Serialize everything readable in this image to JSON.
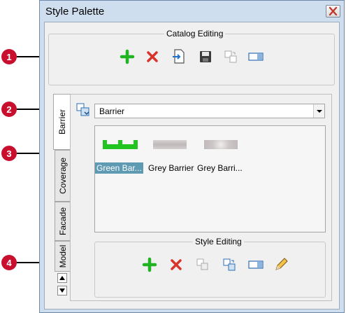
{
  "window": {
    "title": "Style Palette"
  },
  "catalog_editing": {
    "label": "Catalog Editing",
    "buttons": [
      "add-icon",
      "delete-icon",
      "import-icon",
      "save-icon",
      "copy-icon",
      "rename-icon"
    ]
  },
  "tabs": [
    {
      "label": "Barrier",
      "active": true
    },
    {
      "label": "Coverage",
      "active": false
    },
    {
      "label": "Facade",
      "active": false
    },
    {
      "label": "Model",
      "active": false
    }
  ],
  "style_selector": {
    "value": "Barrier"
  },
  "styles": [
    {
      "label": "Green Bar...",
      "selected": true,
      "swatch": "green-barrier"
    },
    {
      "label": "Grey Barrier",
      "selected": false,
      "swatch": "grey-barrier"
    },
    {
      "label": "Grey Barri...",
      "selected": false,
      "swatch": "grey-barrier-light"
    }
  ],
  "style_editing": {
    "label": "Style Editing",
    "buttons": [
      "add-icon",
      "delete-icon",
      "duplicate-icon",
      "copy-icon",
      "rename-icon",
      "edit-pencil-icon"
    ]
  },
  "callouts": [
    "1",
    "2",
    "3",
    "4"
  ],
  "colors": {
    "callout": "#c8102e",
    "selection": "#5f9ab3",
    "green": "#21b321"
  }
}
